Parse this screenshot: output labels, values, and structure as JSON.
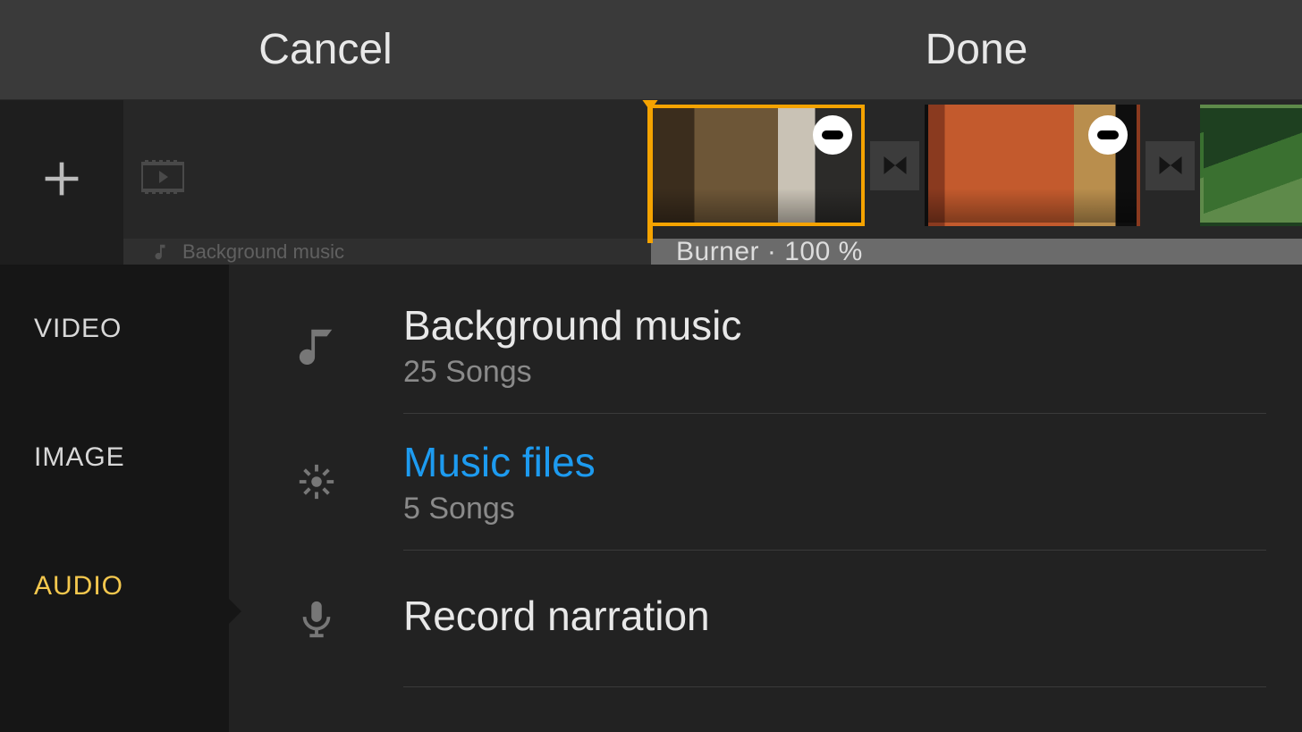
{
  "topbar": {
    "cancel_label": "Cancel",
    "done_label": "Done"
  },
  "timeline": {
    "audio_track_label": "Burner · 100 %",
    "bg_music_hint": "Background music"
  },
  "sidebar": {
    "items": [
      {
        "label": "VIDEO"
      },
      {
        "label": "IMAGE"
      },
      {
        "label": "AUDIO"
      }
    ]
  },
  "audio_panel": {
    "items": [
      {
        "title": "Background music",
        "subtitle": "25 Songs"
      },
      {
        "title": "Music files",
        "subtitle": "5 Songs"
      },
      {
        "title": "Record narration",
        "subtitle": ""
      }
    ]
  }
}
